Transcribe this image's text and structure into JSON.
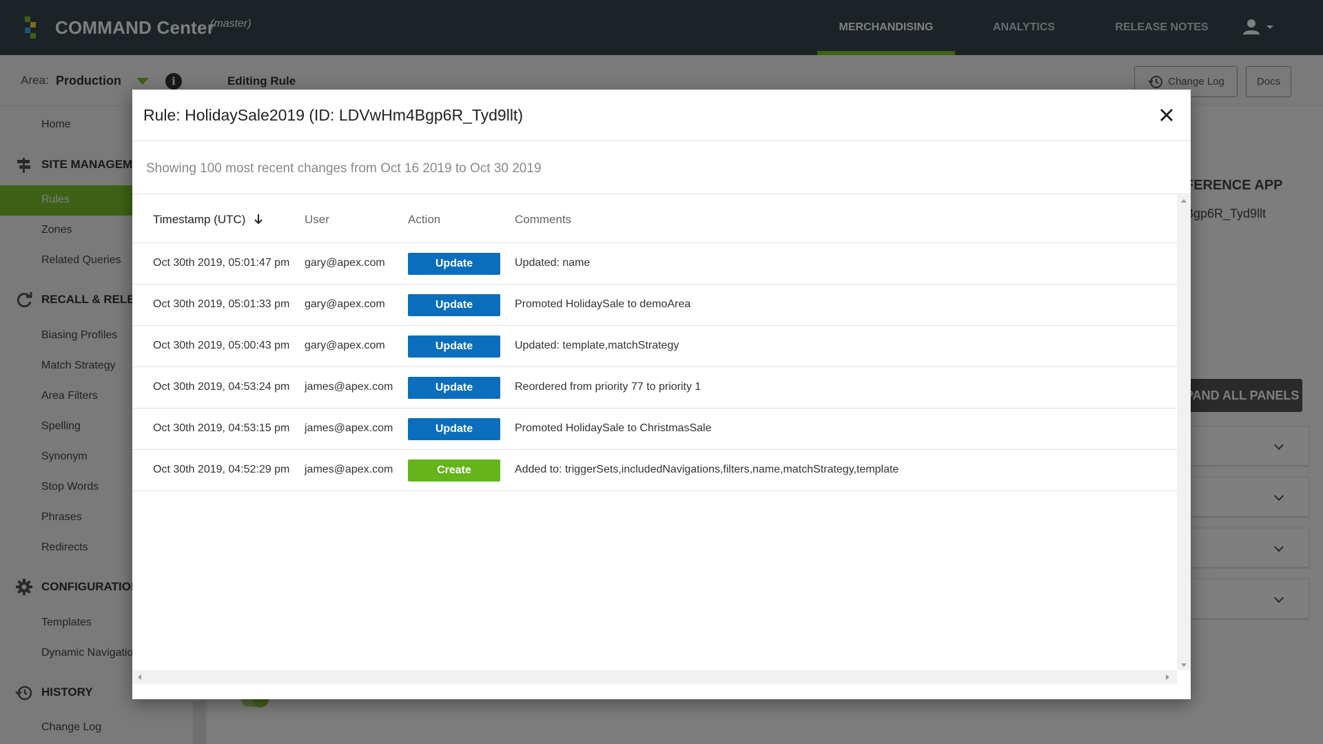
{
  "app": {
    "title": "COMMAND Center",
    "branch": "(master)"
  },
  "nav": {
    "tabs": [
      {
        "label": "MERCHANDISING",
        "active": true
      },
      {
        "label": "ANALYTICS",
        "active": false
      },
      {
        "label": "RELEASE NOTES",
        "active": false
      }
    ]
  },
  "area": {
    "label": "Area:",
    "value": "Production"
  },
  "header": {
    "editing_label": "Editing Rule",
    "change_log_label": "Change Log",
    "docs_label": "Docs"
  },
  "sidebar": {
    "home": "Home",
    "sections": [
      {
        "title": "SITE MANAGEMI",
        "icon": "signpost-icon",
        "items": [
          "Rules",
          "Zones",
          "Related Queries"
        ]
      },
      {
        "title": "RECALL & RELEV",
        "icon": "refresh-icon",
        "items": [
          "Biasing Profiles",
          "Match Strategy",
          "Area Filters",
          "Spelling",
          "Synonym",
          "Stop Words",
          "Phrases",
          "Redirects"
        ]
      },
      {
        "title": "CONFIGURATION",
        "icon": "gear-icon",
        "items": [
          "Templates",
          "Dynamic Navigatio"
        ]
      },
      {
        "title": "HISTORY",
        "icon": "history-icon",
        "items": [
          "Change Log"
        ]
      }
    ],
    "active_item": "Rules"
  },
  "background": {
    "reference_app": "FERENCE APP",
    "rule_id_tail": "Bgp6R_Tyd9llt",
    "expand_label": "PAND ALL PANELS"
  },
  "modal": {
    "title": "Rule: HolidaySale2019 (ID: LDVwHm4Bgp6R_Tyd9llt)",
    "summary": "Showing 100 most recent changes from Oct 16 2019 to Oct 30 2019",
    "columns": {
      "timestamp": "Timestamp (UTC)",
      "user": "User",
      "action": "Action",
      "comments": "Comments"
    },
    "rows": [
      {
        "timestamp": "Oct 30th 2019, 05:01:47 pm",
        "user": "gary@apex.com",
        "action": "Update",
        "comment": "Updated: name"
      },
      {
        "timestamp": "Oct 30th 2019, 05:01:33 pm",
        "user": "gary@apex.com",
        "action": "Update",
        "comment": "Promoted HolidaySale to demoArea"
      },
      {
        "timestamp": "Oct 30th 2019, 05:00:43 pm",
        "user": "gary@apex.com",
        "action": "Update",
        "comment": "Updated: template,matchStrategy"
      },
      {
        "timestamp": "Oct 30th 2019, 04:53:24 pm",
        "user": "james@apex.com",
        "action": "Update",
        "comment": "Reordered from priority 77 to priority 1"
      },
      {
        "timestamp": "Oct 30th 2019, 04:53:15 pm",
        "user": "james@apex.com",
        "action": "Update",
        "comment": "Promoted HolidaySale to ChristmasSale"
      },
      {
        "timestamp": "Oct 30th 2019, 04:52:29 pm",
        "user": "james@apex.com",
        "action": "Create",
        "comment": "Added to: triggerSets,includedNavigations,filters,name,matchStrategy,template"
      }
    ]
  },
  "colors": {
    "topbar": "#37474f",
    "accent_green": "#7cc52a",
    "update_blue": "#0a6ebd",
    "create_green": "#64b41a"
  }
}
